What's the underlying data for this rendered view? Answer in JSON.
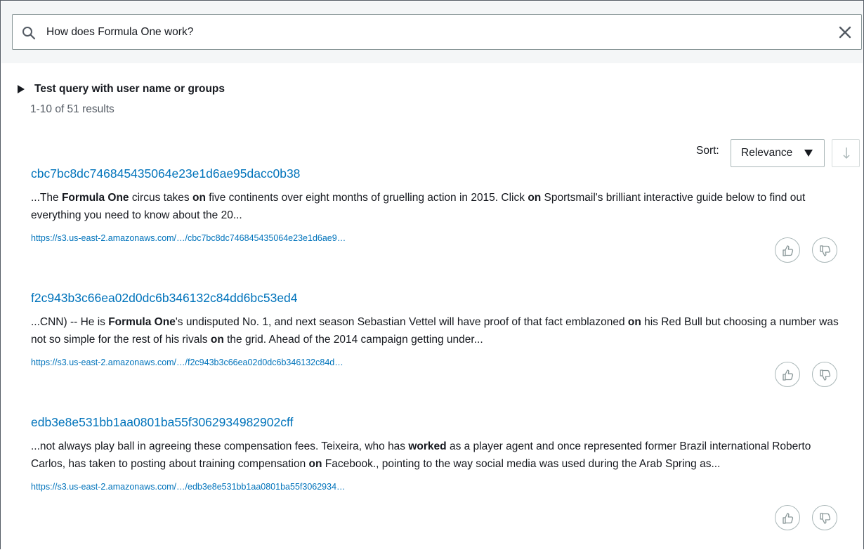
{
  "search": {
    "query": "How does Formula One work?",
    "icon": "search-icon",
    "clear_icon": "close-icon"
  },
  "toggle": {
    "label": "Test query with user name or groups"
  },
  "results_summary": "1-10 of 51 results",
  "sort": {
    "label": "Sort:",
    "value": "Relevance",
    "direction_icon": "arrow-down-icon"
  },
  "results": [
    {
      "title": "cbc7bc8dc746845435064e23e1d6ae95dacc0b38",
      "excerpt_parts": [
        {
          "t": "...The ",
          "b": false
        },
        {
          "t": "Formula One",
          "b": true
        },
        {
          "t": " circus takes ",
          "b": false
        },
        {
          "t": "on",
          "b": true
        },
        {
          "t": " five continents over eight months of gruelling action in 2015. Click ",
          "b": false
        },
        {
          "t": "on",
          "b": true
        },
        {
          "t": " Sportsmail's brilliant interactive guide below to find out everything you need to know about the 20...",
          "b": false
        }
      ],
      "url": "https://s3.us-east-2.amazonaws.com/…/cbc7bc8dc746845435064e23e1d6ae9…"
    },
    {
      "title": "f2c943b3c66ea02d0dc6b346132c84dd6bc53ed4",
      "excerpt_parts": [
        {
          "t": "...CNN) -- He is ",
          "b": false
        },
        {
          "t": "Formula One",
          "b": true
        },
        {
          "t": "'s undisputed No. 1, and next season Sebastian Vettel will have proof of that fact emblazoned ",
          "b": false
        },
        {
          "t": "on",
          "b": true
        },
        {
          "t": " his Red Bull but choosing a number was not so simple for the rest of his rivals ",
          "b": false
        },
        {
          "t": "on",
          "b": true
        },
        {
          "t": " the grid. Ahead of the 2014 campaign getting under...",
          "b": false
        }
      ],
      "url": "https://s3.us-east-2.amazonaws.com/…/f2c943b3c66ea02d0dc6b346132c84d…"
    },
    {
      "title": "edb3e8e531bb1aa0801ba55f3062934982902cff",
      "excerpt_parts": [
        {
          "t": "...not always play ball in agreeing these compensation fees. Teixeira, who has ",
          "b": false
        },
        {
          "t": "worked",
          "b": true
        },
        {
          "t": " as a player agent and once represented former Brazil international Roberto Carlos, has taken to posting about training compensation ",
          "b": false
        },
        {
          "t": "on",
          "b": true
        },
        {
          "t": " Facebook., pointing to the way social media was used during the Arab Spring as...",
          "b": false
        }
      ],
      "url": "https://s3.us-east-2.amazonaws.com/…/edb3e8e531bb1aa0801ba55f3062934…"
    }
  ],
  "feedback": {
    "up_icon": "thumbs-up-icon",
    "down_icon": "thumbs-down-icon"
  },
  "colors": {
    "link": "#0073bb",
    "text": "#16191f",
    "muted": "#545b64",
    "search_bg": "#f4f6f7"
  }
}
